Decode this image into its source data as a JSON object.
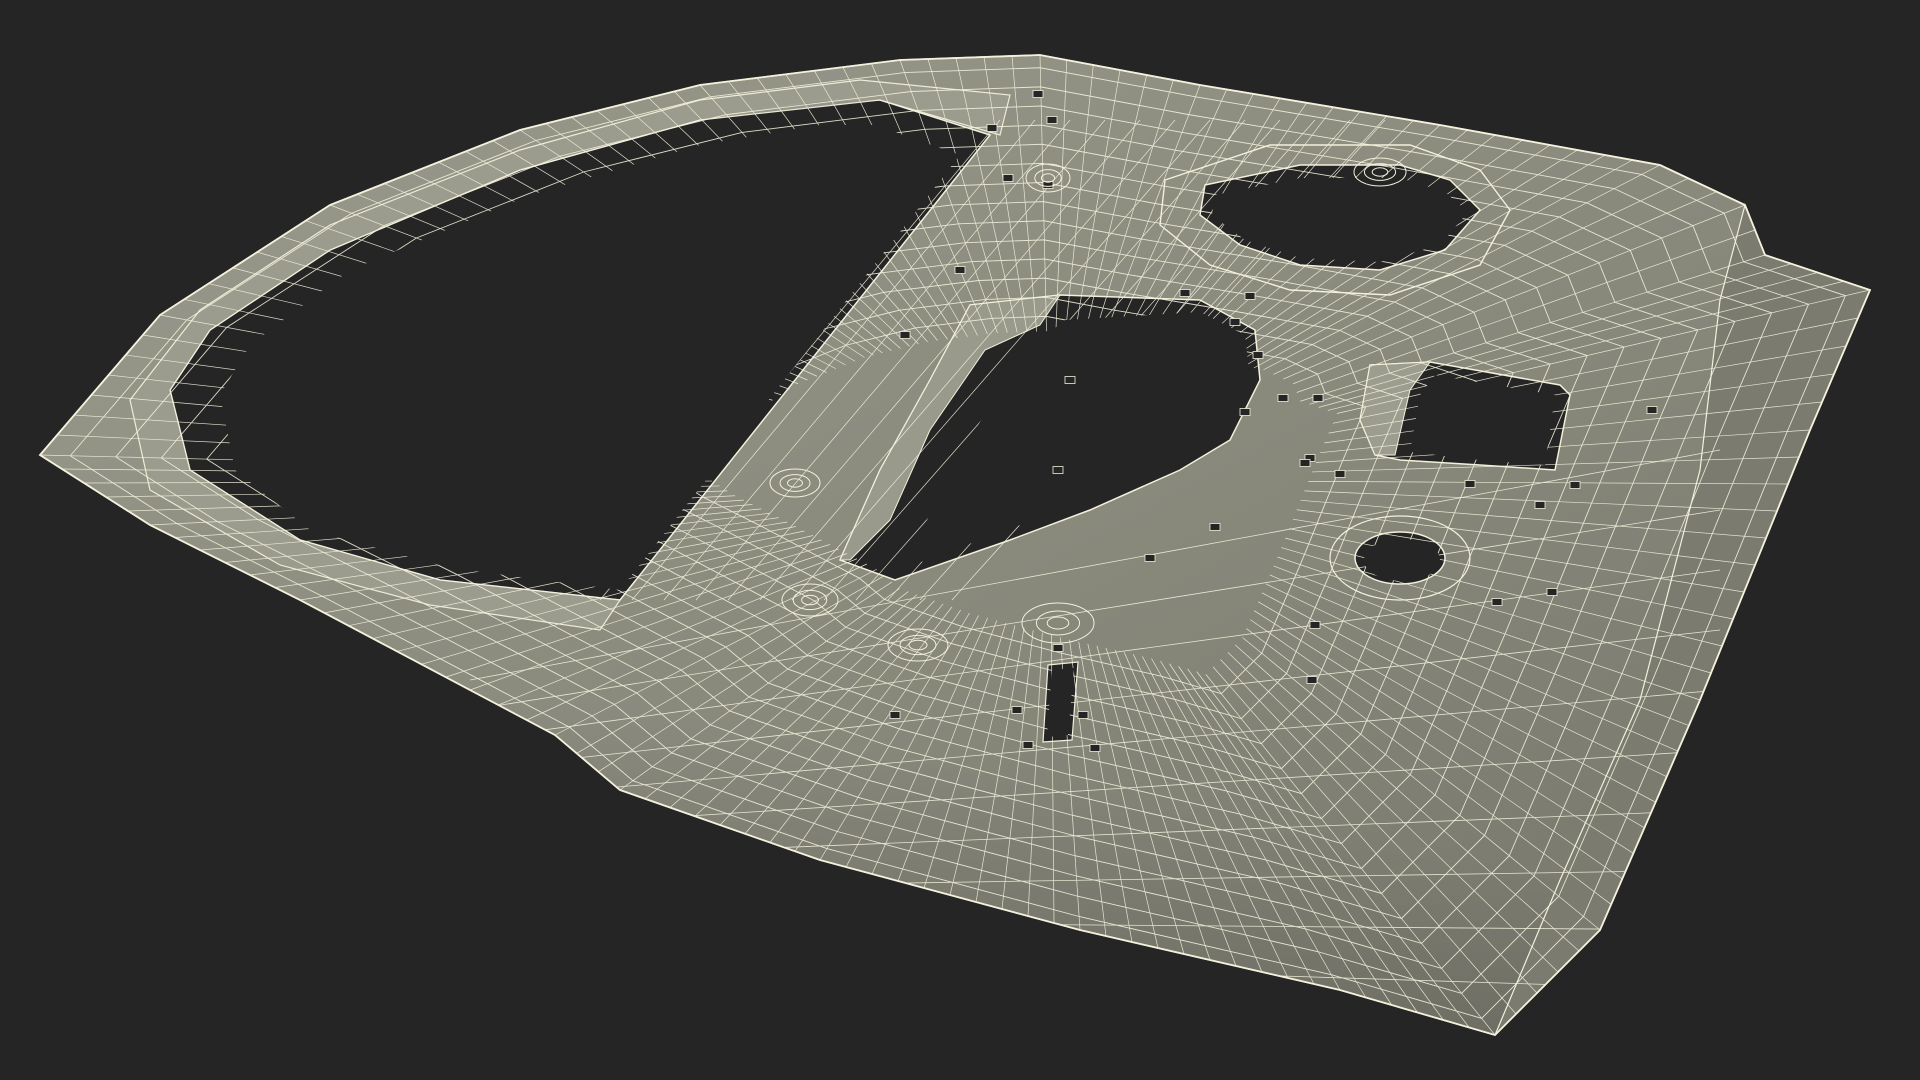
{
  "colors": {
    "background": "#252525",
    "surface": "#8a8a7d",
    "surface_shadow": "#6f6f64",
    "surface_light": "#a2a295",
    "wire": "#f3f1dc",
    "hole": "#252525"
  },
  "object": {
    "kind": "car-door-inner-panel",
    "render_style": "wireframe-over-shaded"
  }
}
